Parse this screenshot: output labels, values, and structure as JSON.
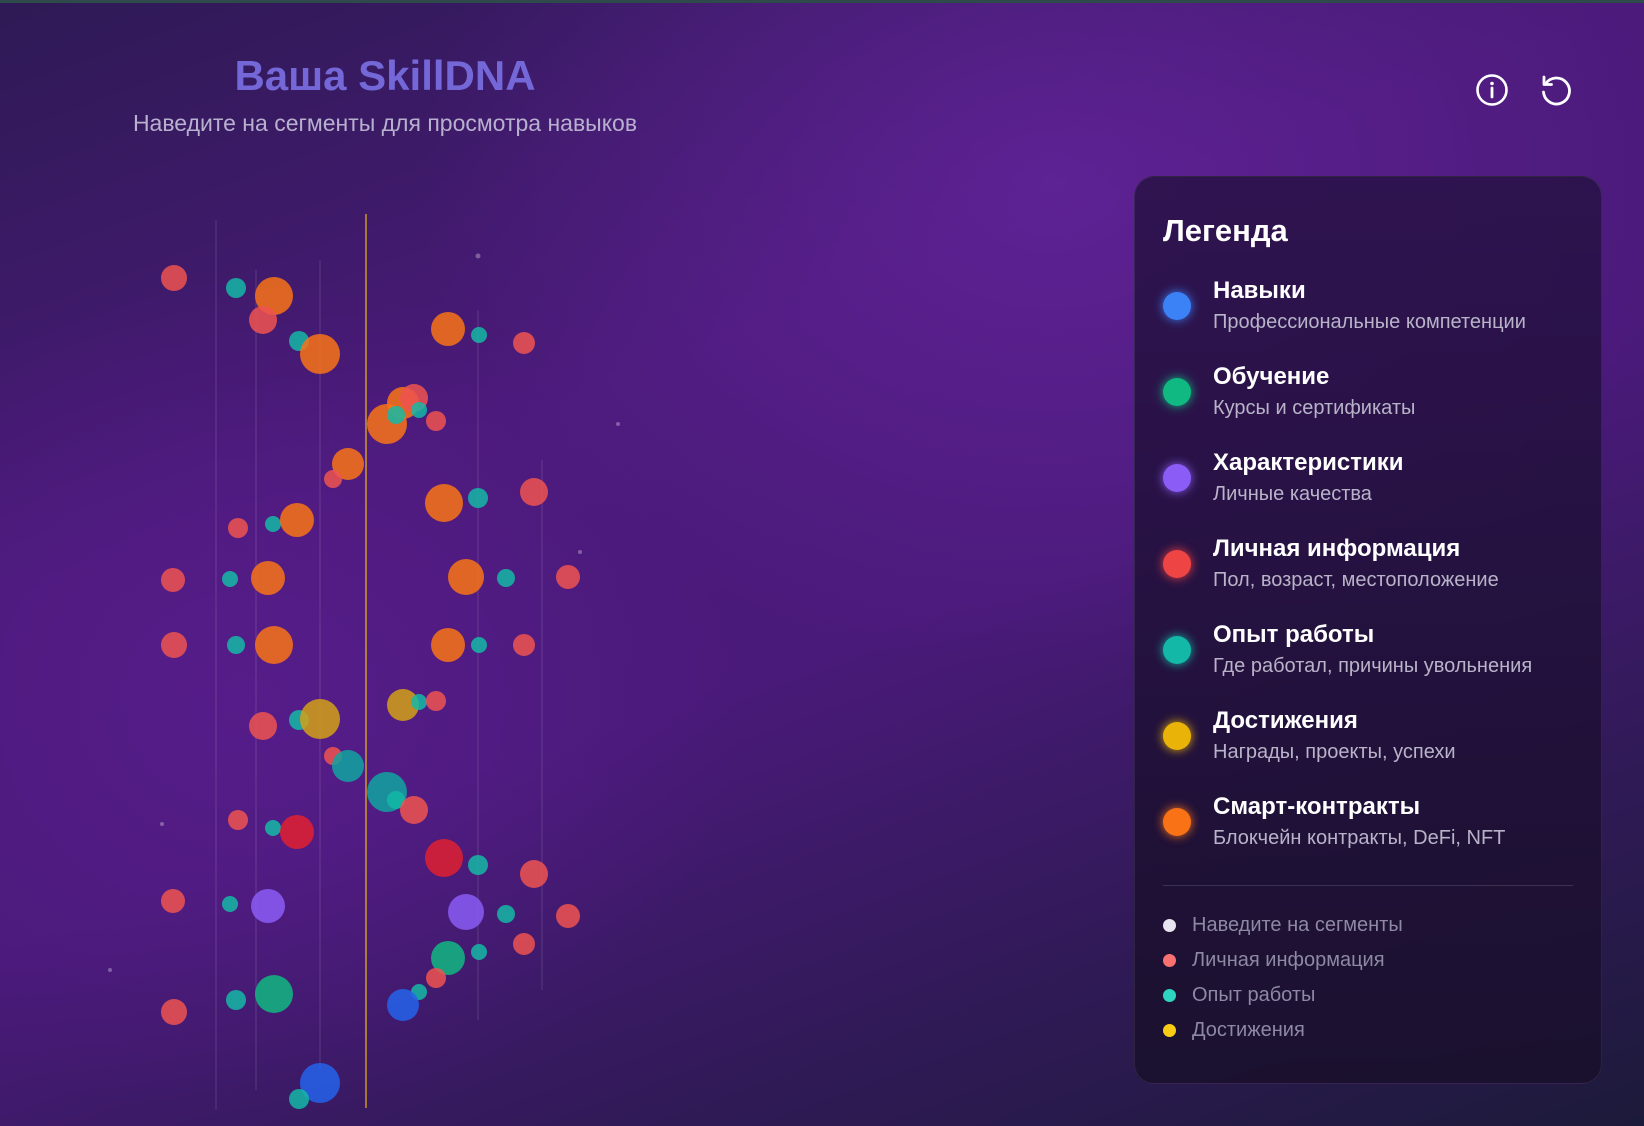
{
  "header": {
    "title": "Ваша SkillDNA",
    "subtitle": "Наведите на сегменты для просмотра навыков"
  },
  "toolbar": {
    "info_icon": "info-icon",
    "reset_icon": "refresh-icon"
  },
  "colors": {
    "title": "#7468d9",
    "skills": "#3b82f6",
    "education": "#10b981",
    "traits": "#8b5cf6",
    "personal": "#ef4444",
    "work": "#14b8a6",
    "achievements": "#eab308",
    "contracts": "#f97316",
    "strand_line": "#d4a017"
  },
  "legend": {
    "title": "Легенда",
    "items": [
      {
        "label": "Навыки",
        "desc": "Профессиональные компетенции",
        "color": "#3b82f6"
      },
      {
        "label": "Обучение",
        "desc": "Курсы и сертификаты",
        "color": "#10b981"
      },
      {
        "label": "Характеристики",
        "desc": "Личные качества",
        "color": "#8b5cf6"
      },
      {
        "label": "Личная информация",
        "desc": "Пол, возраст, местоположение",
        "color": "#ef4444"
      },
      {
        "label": "Опыт работы",
        "desc": "Где работал, причины увольнения",
        "color": "#14b8a6"
      },
      {
        "label": "Достижения",
        "desc": "Награды, проекты, успехи",
        "color": "#eab308"
      },
      {
        "label": "Смарт-контракты",
        "desc": "Блокчейн контракты, DeFi, NFT",
        "color": "#f97316"
      }
    ],
    "status": [
      {
        "label": "Наведите на сегменты",
        "color": "#e8e4f0"
      },
      {
        "label": "Личная информация",
        "color": "#f87171"
      },
      {
        "label": "Опыт работы",
        "color": "#2dd4bf"
      },
      {
        "label": "Достижения",
        "color": "#facc15"
      }
    ]
  }
}
